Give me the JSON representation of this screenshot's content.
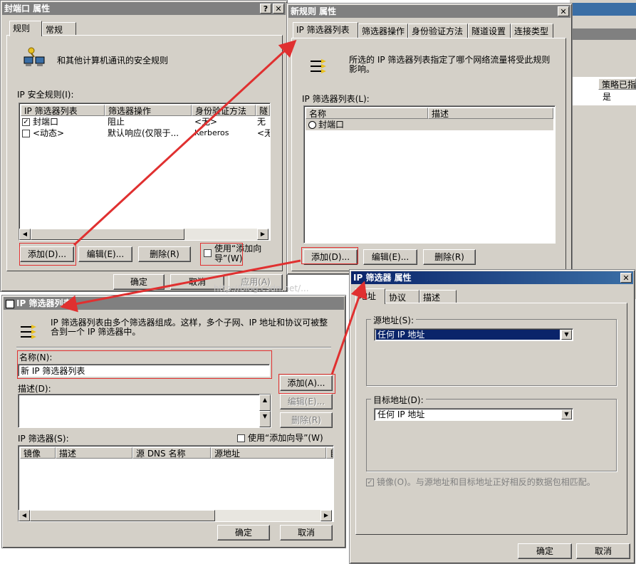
{
  "win1": {
    "title": "封端口 属性",
    "tabs": [
      "规则",
      "常规"
    ],
    "description": "和其他计算机通讯的安全规则",
    "rules_label": "IP 安全规则(I):",
    "columns": [
      "IP 筛选器列表",
      "筛选器操作",
      "身份验证方法",
      "隧"
    ],
    "rows": [
      {
        "checked": true,
        "name": "封端口",
        "action": "阻止",
        "auth": "<无>",
        "tunnel": "无"
      },
      {
        "checked": false,
        "name": "<动态>",
        "action": "默认响应(仅限于...",
        "auth": "Kerberos",
        "tunnel": "<无"
      }
    ],
    "add_label": "添加(D)...",
    "edit_label": "编辑(E)...",
    "remove_label": "删除(R)",
    "wizard_label": "使用“添加向导”(W)",
    "ok_label": "确定",
    "cancel_label": "取消",
    "apply_label": "应用(A)"
  },
  "win2": {
    "title": "新规则 属性",
    "tabs": [
      "IP 筛选器列表",
      "筛选器操作",
      "身份验证方法",
      "隧道设置",
      "连接类型"
    ],
    "description": "所选的 IP 筛选器列表指定了哪个网络流量将受此规则影响。",
    "list_label": "IP 筛选器列表(L):",
    "columns": [
      "名称",
      "描述"
    ],
    "rows": [
      {
        "name": "封端口"
      }
    ],
    "add_label": "添加(D)...",
    "edit_label": "编辑(E)...",
    "remove_label": "删除(R)"
  },
  "bg_window": {
    "column": "策略已指",
    "value": "是"
  },
  "win3": {
    "title": "IP 筛选器列表",
    "description": "IP 筛选器列表由多个筛选器组成。这样，多个子网、IP 地址和协议可被整合到一个 IP 筛选器中。",
    "name_label": "名称(N):",
    "name_value": "新 IP 筛选器列表",
    "desc_label": "描述(D):",
    "add_label": "添加(A)...",
    "edit_label": "编辑(E)...",
    "remove_label": "删除(R)",
    "filters_label": "IP 筛选器(S):",
    "wizard_label": "使用“添加向导”(W)",
    "columns": [
      "镜像",
      "描述",
      "源 DNS 名称",
      "源地址",
      "目"
    ],
    "ok_label": "确定",
    "cancel_label": "取消"
  },
  "win4": {
    "title": "IP 筛选器 属性",
    "tabs": [
      "地址",
      "协议",
      "描述"
    ],
    "source_label": "源地址(S):",
    "source_value": "任何 IP 地址",
    "dest_label": "目标地址(D):",
    "dest_value": "任何 IP 地址",
    "mirror_label": "镜像(O)。与源地址和目标地址正好相反的数据包相匹配。",
    "ok_label": "确定",
    "cancel_label": "取消"
  },
  "watermark": "http://blog.csdn.net/...",
  "colors": {
    "annotation": "#e03030",
    "active_title": "#0a246a",
    "face": "#d4d0c8"
  }
}
